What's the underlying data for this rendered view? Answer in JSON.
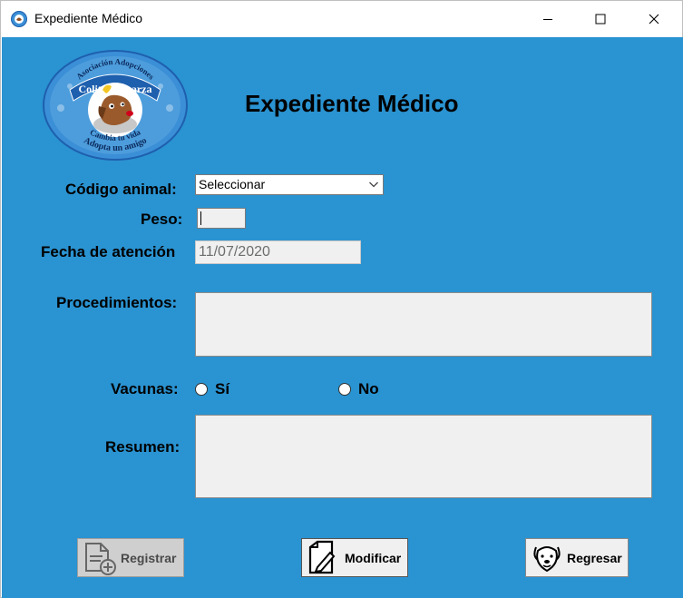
{
  "window": {
    "title": "Expediente Médico",
    "app_icon": "app-logo-icon"
  },
  "logo": {
    "arc_top": "Asociación Adopciones",
    "name": "Colitas Esparza",
    "arc_bottom_1": "Cambia tu vida",
    "arc_bottom_2": "Adopta un amigo"
  },
  "form": {
    "heading": "Expediente Médico",
    "codigo_label": "Código animal:",
    "codigo_value": "Seleccionar",
    "peso_label": "Peso:",
    "fecha_label": "Fecha de atención",
    "fecha_value": "11/07/2020",
    "procedimientos_label": "Procedimientos:",
    "vacunas_label": "Vacunas:",
    "vacunas_si": "Sí",
    "vacunas_no": "No",
    "resumen_label": "Resumen:"
  },
  "buttons": {
    "registrar": "Registrar",
    "modificar": "Modificar",
    "regresar": "Regresar"
  },
  "colors": {
    "background": "#2a93d1",
    "logo_ring": "#3b8fd6",
    "logo_ribbon": "#1e5fae"
  }
}
